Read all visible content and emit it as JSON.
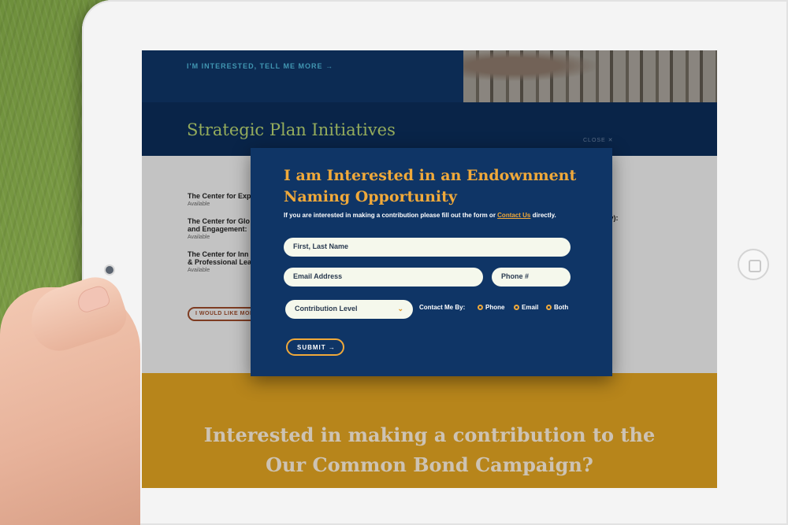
{
  "page": {
    "top_link": "I'M INTERESTED, TELL ME MORE →",
    "section_title": "Strategic Plan Initiatives",
    "close_label": "CLOSE ✕",
    "initiatives": [
      {
        "name_line1": "The Center for Exp",
        "name_line2": "",
        "status": "Available"
      },
      {
        "name_line1": "The Center for Glo",
        "name_line2": "and Engagement:",
        "status": "Available"
      },
      {
        "name_line1": "The Center for Inn",
        "name_line2": "& Professional Lea",
        "status": "Available"
      }
    ],
    "right_fragment": "ny):",
    "outline_button": "I WOULD LIKE MORE",
    "cta_line1": "Interested in making a contribution to the",
    "cta_line2": "Our Common Bond Campaign?"
  },
  "modal": {
    "title": "I am Interested in an Endownment Naming Opportunity",
    "intro_before": "If you are interested in making a contribution please fill out the form or ",
    "intro_link": "Contact Us",
    "intro_after": " directly.",
    "fields": {
      "name_placeholder": "First, Last Name",
      "email_placeholder": "Email Address",
      "phone_placeholder": "Phone #",
      "contribution_level": "Contribution Level"
    },
    "contact_label": "Contact Me By:",
    "contact_options": [
      "Phone",
      "Email",
      "Both"
    ],
    "submit_label": "SUBMIT →"
  },
  "colors": {
    "navy": "#0f3566",
    "gold": "#e0a321",
    "orange_accent": "#f0a93a",
    "green_title": "#b6d271"
  }
}
